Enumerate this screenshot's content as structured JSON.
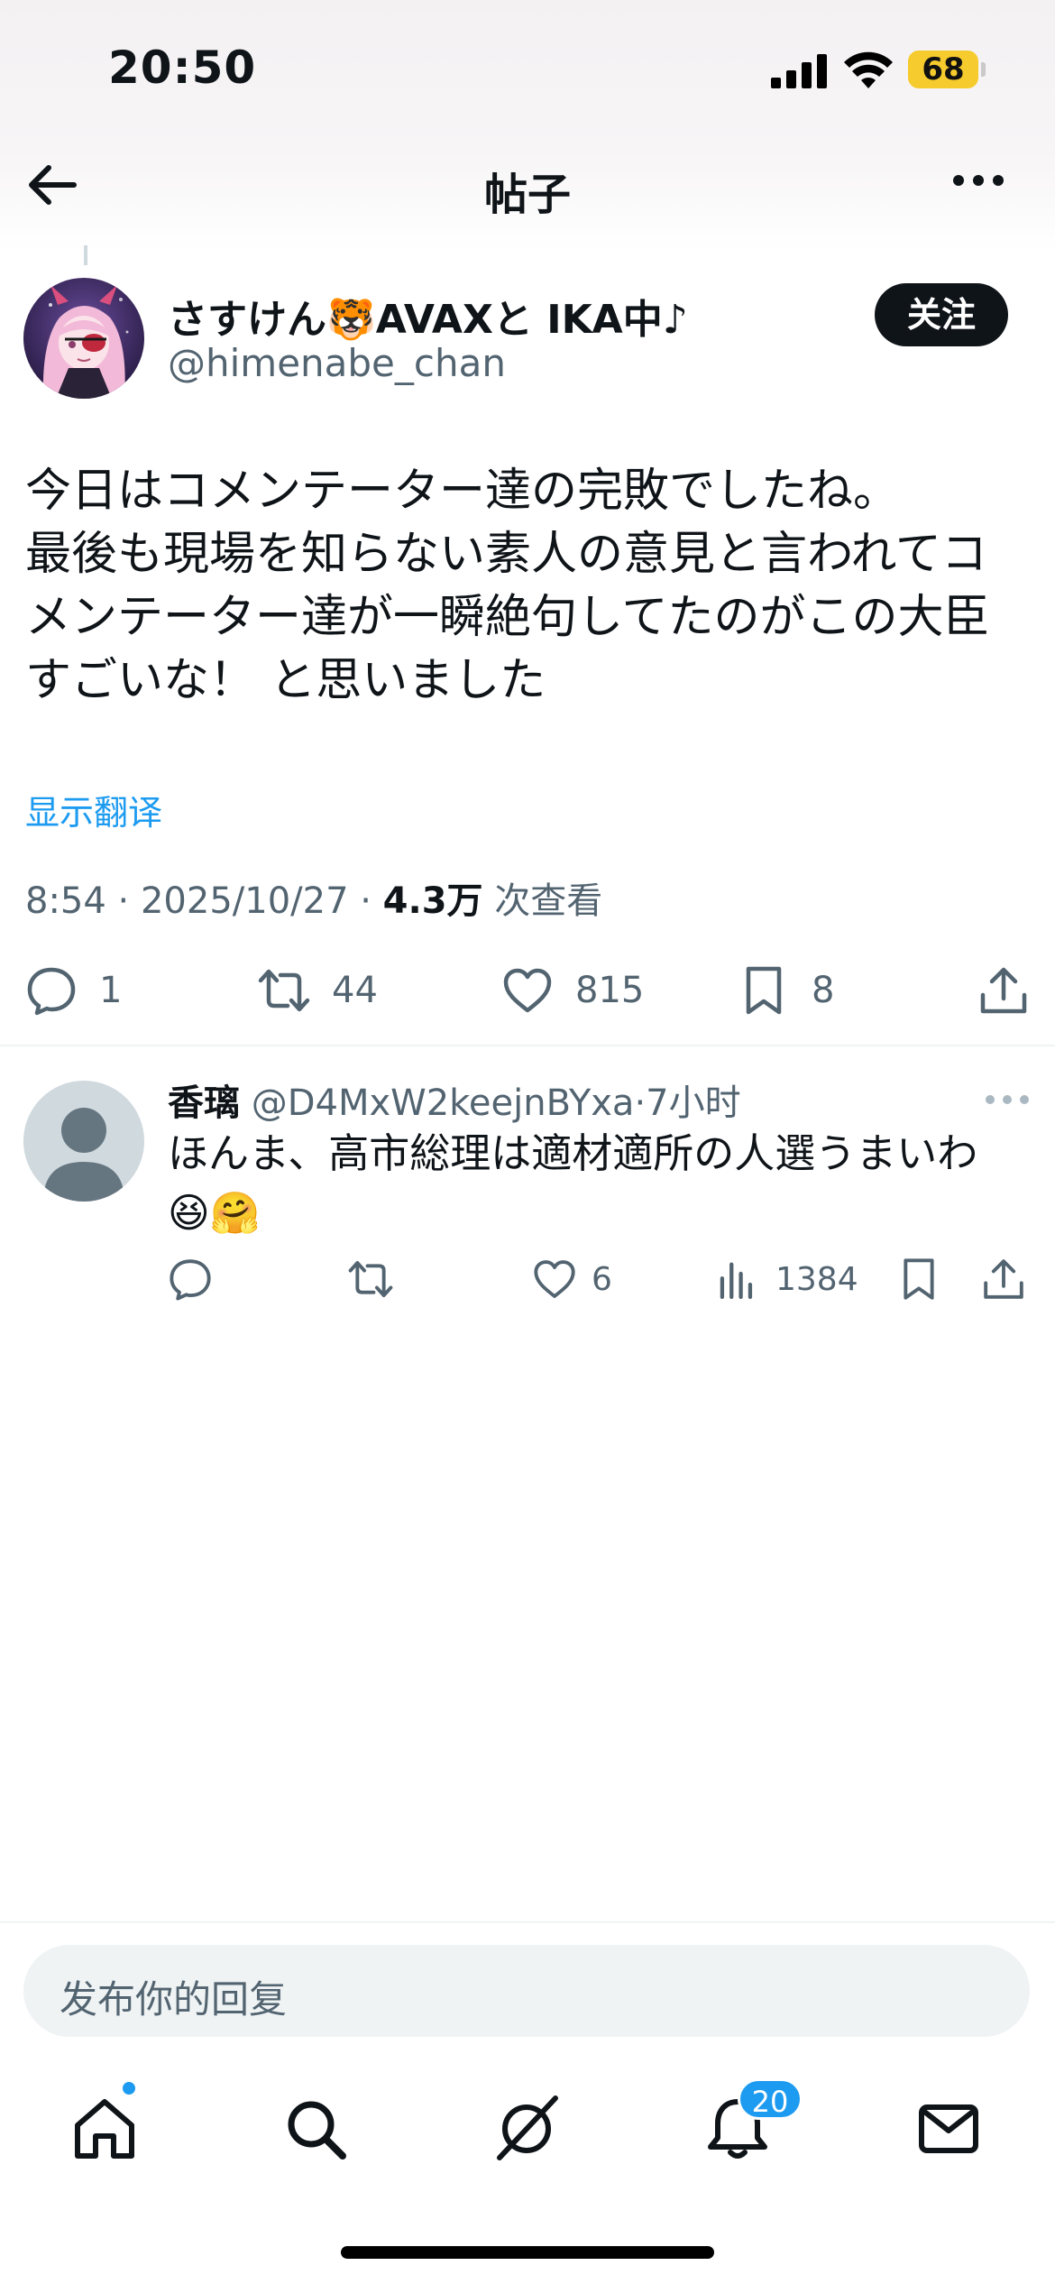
{
  "status_bar": {
    "time": "20:50",
    "battery": "68",
    "battery_color": "#f5cb2d"
  },
  "nav": {
    "title": "帖子",
    "back_icon": "arrow-left-icon",
    "more_icon": "more-horizontal-icon"
  },
  "post": {
    "author_name": "さすけん🐯AVAXと IKA中♪",
    "author_handle": "@himenabe_chan",
    "follow_label": "关注",
    "text_lines": [
      "今日はコメンテーター達の完敗でしたね。",
      "最後も現場を知らない素人の意見と言われてコ",
      "メンテーター達が一瞬絶句してたのがこの大臣",
      "すごいな！ と思いました"
    ],
    "translate_label": "显示翻译",
    "time_date": "8:54 · 2025/10/27 · ",
    "views_count": "4.3万",
    "views_label": " 次查看",
    "actions": {
      "replies": "1",
      "retweets": "44",
      "likes": "815",
      "bookmarks": "8"
    }
  },
  "reply": {
    "name": "香璃",
    "handle": "@D4MxW2keejnBYxa",
    "time": "·7小时",
    "text_line1": "ほんま、高市総理は適材適所の人選うまいわ",
    "text_line2": "😆🤗",
    "actions": {
      "likes": "6",
      "views": "1384"
    }
  },
  "compose": {
    "placeholder": "发布你的回复"
  },
  "tab_bar": {
    "notifications_badge": "20",
    "tabs": [
      "home-icon",
      "search-icon",
      "grok-icon",
      "notifications-icon",
      "messages-icon"
    ]
  },
  "colors": {
    "accent": "#1d9bf0",
    "text_primary": "#0f1419",
    "text_secondary": "#536471"
  }
}
